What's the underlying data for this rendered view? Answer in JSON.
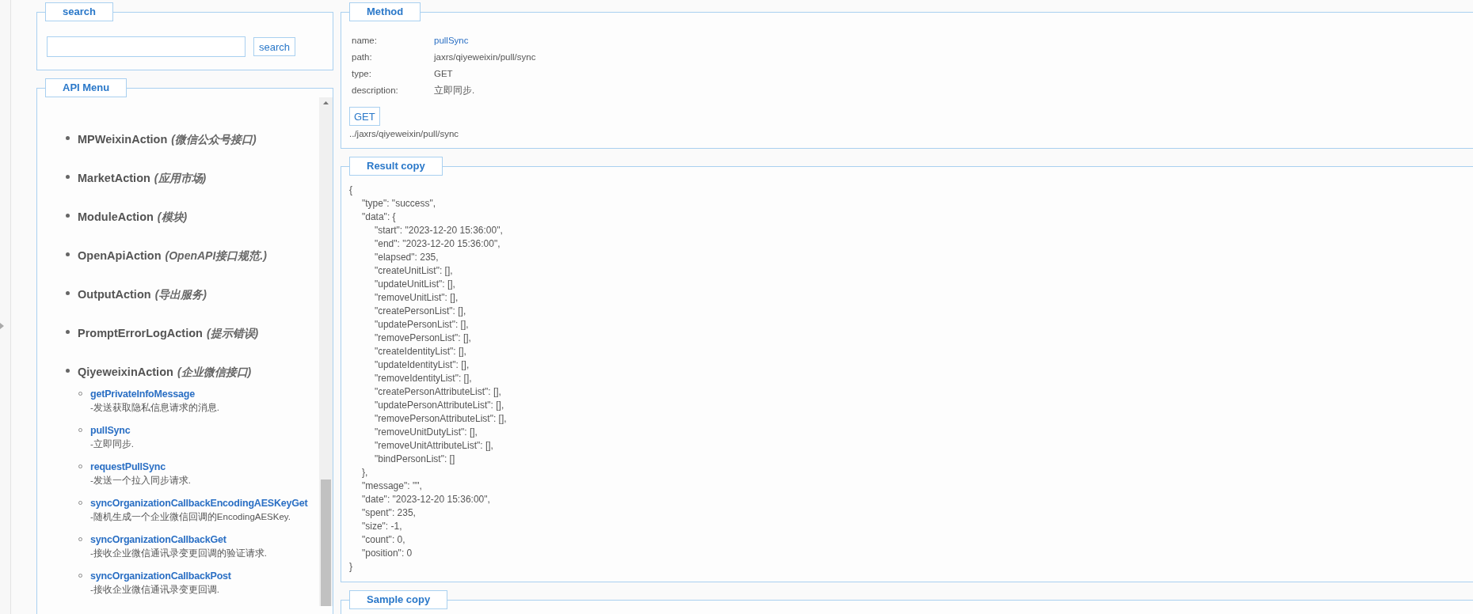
{
  "search": {
    "legend": "search",
    "button": "search"
  },
  "api_menu": {
    "legend": "API Menu",
    "items": [
      {
        "name": "MPWeixinAction",
        "description": "(微信公众号接口)"
      },
      {
        "name": "MarketAction",
        "description": "(应用市场)"
      },
      {
        "name": "ModuleAction",
        "description": "(模块)"
      },
      {
        "name": "OpenApiAction",
        "description": "(OpenAPI接口规范.)"
      },
      {
        "name": "OutputAction",
        "description": "(导出服务)"
      },
      {
        "name": "PromptErrorLogAction",
        "description": "(提示错误)"
      },
      {
        "name": "QiyeweixinAction",
        "description": "(企业微信接口)",
        "children": [
          {
            "name": "getPrivateInfoMessage",
            "description": "-发送获取隐私信息请求的消息."
          },
          {
            "name": "pullSync",
            "description": "-立即同步."
          },
          {
            "name": "requestPullSync",
            "description": "-发送一个拉入同步请求."
          },
          {
            "name": "syncOrganizationCallbackEncodingAESKeyGet",
            "description": "-随机生成一个企业微信回调的EncodingAESKey."
          },
          {
            "name": "syncOrganizationCallbackGet",
            "description": "-接收企业微信通讯录变更回调的验证请求."
          },
          {
            "name": "syncOrganizationCallbackPost",
            "description": "-接收企业微信通讯录变更回调."
          }
        ]
      }
    ]
  },
  "method": {
    "legend": "Method",
    "fields": [
      {
        "label": "name:",
        "value": "pullSync",
        "kind": "link"
      },
      {
        "label": "path:",
        "value": "jaxrs/qiyeweixin/pull/sync",
        "kind": "text"
      },
      {
        "label": "type:",
        "value": "GET",
        "kind": "text"
      },
      {
        "label": "description:",
        "value": "立即同步.",
        "kind": "text"
      }
    ],
    "button": "GET",
    "url": "../jaxrs/qiyeweixin/pull/sync"
  },
  "result": {
    "legend": "Result copy",
    "text": "{\n\t\"type\": \"success\",\n\t\"data\": {\n\t\t\"start\": \"2023-12-20 15:36:00\",\n\t\t\"end\": \"2023-12-20 15:36:00\",\n\t\t\"elapsed\": 235,\n\t\t\"createUnitList\": [],\n\t\t\"updateUnitList\": [],\n\t\t\"removeUnitList\": [],\n\t\t\"createPersonList\": [],\n\t\t\"updatePersonList\": [],\n\t\t\"removePersonList\": [],\n\t\t\"createIdentityList\": [],\n\t\t\"updateIdentityList\": [],\n\t\t\"removeIdentityList\": [],\n\t\t\"createPersonAttributeList\": [],\n\t\t\"updatePersonAttributeList\": [],\n\t\t\"removePersonAttributeList\": [],\n\t\t\"removeUnitDutyList\": [],\n\t\t\"removeUnitAttributeList\": [],\n\t\t\"bindPersonList\": []\n\t},\n\t\"message\": \"\",\n\t\"date\": \"2023-12-20 15:36:00\",\n\t\"spent\": 235,\n\t\"size\": -1,\n\t\"count\": 0,\n\t\"position\": 0\n}"
  },
  "sample": {
    "legend": "Sample copy"
  }
}
